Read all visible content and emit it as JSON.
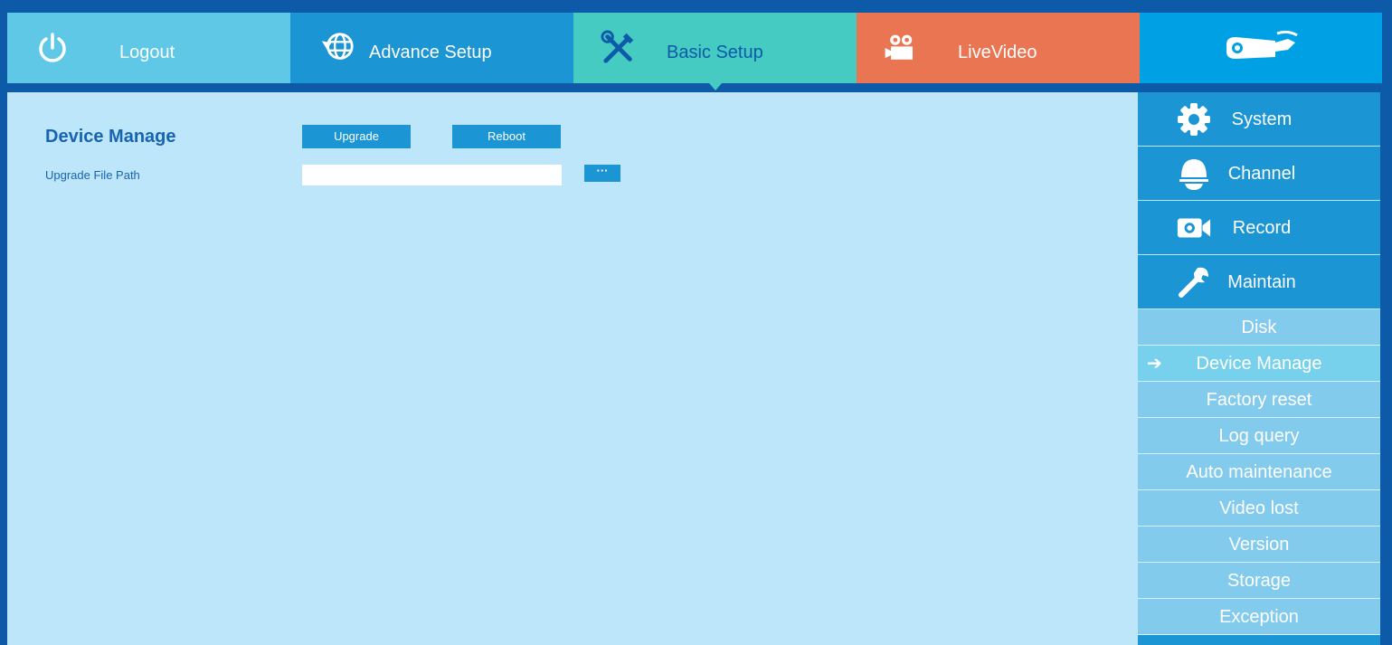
{
  "topnav": {
    "logout_label": "Logout",
    "advance_label": "Advance Setup",
    "basic_label": "Basic Setup",
    "live_label": "LiveVideo"
  },
  "content": {
    "title": "Device Manage",
    "upgrade_button": "Upgrade",
    "reboot_button": "Reboot",
    "file_path_label": "Upgrade File Path",
    "file_path_value": "",
    "browse_button": "···"
  },
  "sidebar": {
    "main": [
      {
        "label": "System",
        "icon": "gear-icon"
      },
      {
        "label": "Channel",
        "icon": "dome-camera-icon"
      },
      {
        "label": "Record",
        "icon": "video-camera-icon"
      },
      {
        "label": "Maintain",
        "icon": "wrench-icon"
      }
    ],
    "sub": [
      {
        "label": "Disk"
      },
      {
        "label": "Device Manage",
        "active": true
      },
      {
        "label": "Factory reset"
      },
      {
        "label": "Log query"
      },
      {
        "label": "Auto maintenance"
      },
      {
        "label": "Video lost"
      },
      {
        "label": "Version"
      },
      {
        "label": "Storage"
      },
      {
        "label": "Exception"
      }
    ],
    "active_arrow": "➔"
  },
  "colors": {
    "background": "#0c5aa8",
    "tab_logout": "#5ec8e6",
    "tab_advance": "#1b95d4",
    "tab_basic": "#45cbc2",
    "tab_live": "#e97553",
    "tab_logo": "#00a1e4",
    "content_bg": "#bde6fa",
    "accent": "#1764b0"
  }
}
